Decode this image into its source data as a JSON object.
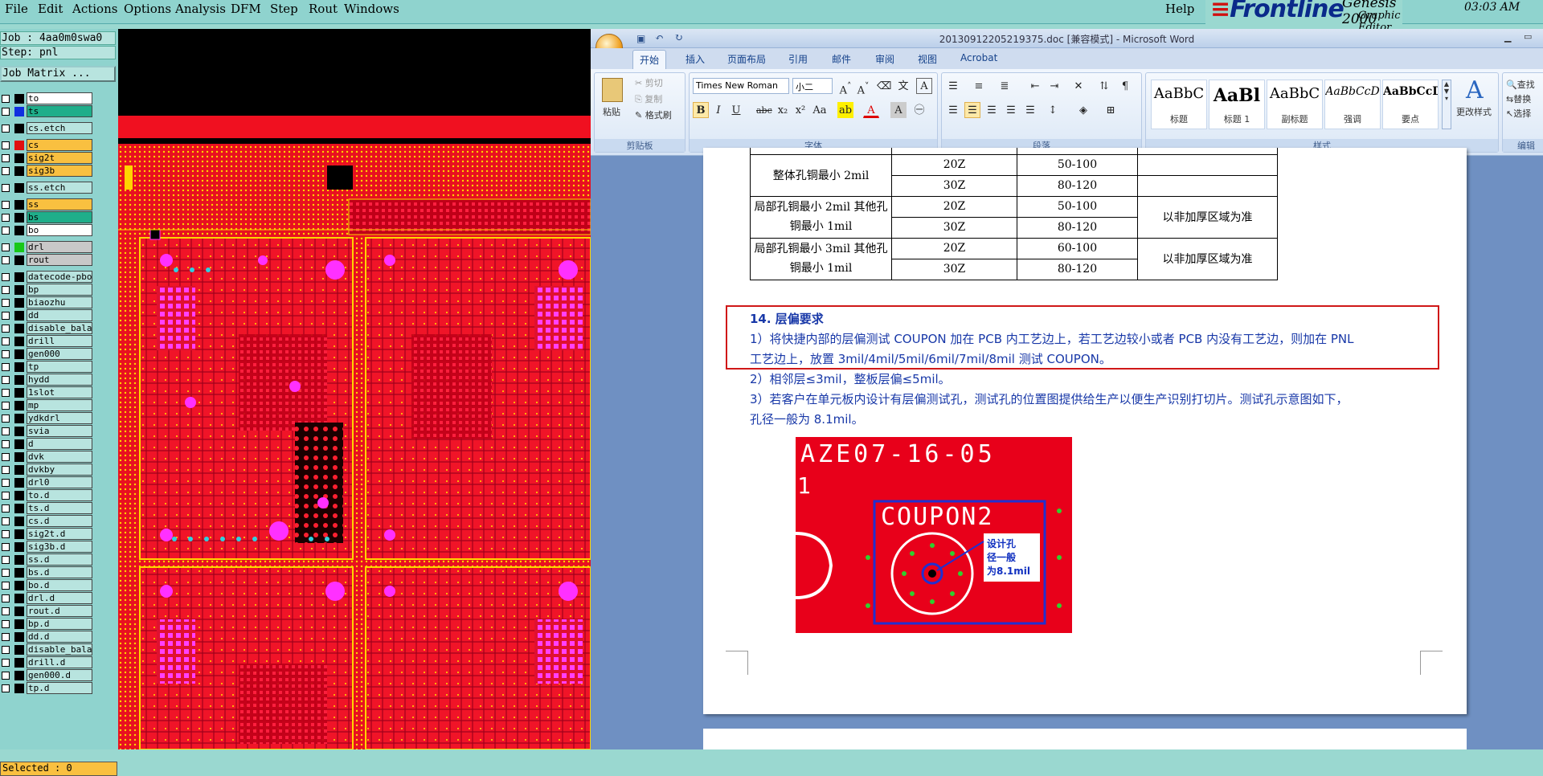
{
  "menubar": {
    "items": [
      "File",
      "Edit",
      "Actions",
      "Options",
      "Analysis",
      "DFM",
      "Step",
      "Rout",
      "Windows"
    ],
    "help": "Help",
    "brand": "Frontline",
    "product": "Genesis 2000",
    "subtitle": "Graphic Editor",
    "clock": "03:03 AM"
  },
  "left": {
    "job": "Job : 4aa0m0swa0",
    "step": "Step: pnl",
    "matrix": "Job Matrix ...",
    "layers": [
      {
        "name": "to",
        "bg": "#ffffff",
        "sw": "#000000"
      },
      {
        "name": "ts",
        "bg": "#1fae8a",
        "sw": "#1030e0"
      },
      {
        "name": "cs.etch",
        "bg": "#b8e4df",
        "sw": "#000000"
      },
      {
        "name": "cs",
        "bg": "#f9c040",
        "sw": "#e01010"
      },
      {
        "name": "sig2t",
        "bg": "#f9c040",
        "sw": "#000000"
      },
      {
        "name": "sig3b",
        "bg": "#f9c040",
        "sw": "#000000"
      },
      {
        "name": "ss.etch",
        "bg": "#b8e4df",
        "sw": "#000000"
      },
      {
        "name": "ss",
        "bg": "#f9c040",
        "sw": "#000000"
      },
      {
        "name": "bs",
        "bg": "#1fae8a",
        "sw": "#000000"
      },
      {
        "name": "bo",
        "bg": "#ffffff",
        "sw": "#000000"
      },
      {
        "name": "drl",
        "bg": "#c8c8c8",
        "sw": "#18c818"
      },
      {
        "name": "rout",
        "bg": "#c8c8c8",
        "sw": "#000000"
      },
      {
        "name": "datecode-pbo",
        "bg": "#b8e4df",
        "sw": "#000000"
      },
      {
        "name": "bp",
        "bg": "#b8e4df",
        "sw": "#000000"
      },
      {
        "name": "biaozhu",
        "bg": "#b8e4df",
        "sw": "#000000"
      },
      {
        "name": "dd",
        "bg": "#b8e4df",
        "sw": "#000000"
      },
      {
        "name": "disable_bala",
        "bg": "#b8e4df",
        "sw": "#000000"
      },
      {
        "name": "drill",
        "bg": "#b8e4df",
        "sw": "#000000"
      },
      {
        "name": "gen000",
        "bg": "#b8e4df",
        "sw": "#000000"
      },
      {
        "name": "tp",
        "bg": "#b8e4df",
        "sw": "#000000"
      },
      {
        "name": "hydd",
        "bg": "#b8e4df",
        "sw": "#000000"
      },
      {
        "name": "1slot",
        "bg": "#b8e4df",
        "sw": "#000000"
      },
      {
        "name": "mp",
        "bg": "#b8e4df",
        "sw": "#000000"
      },
      {
        "name": "ydkdrl",
        "bg": "#b8e4df",
        "sw": "#000000"
      },
      {
        "name": "svia",
        "bg": "#b8e4df",
        "sw": "#000000"
      },
      {
        "name": "d",
        "bg": "#b8e4df",
        "sw": "#000000"
      },
      {
        "name": "dvk",
        "bg": "#b8e4df",
        "sw": "#000000"
      },
      {
        "name": "dvkby",
        "bg": "#b8e4df",
        "sw": "#000000"
      },
      {
        "name": "drl0",
        "bg": "#b8e4df",
        "sw": "#000000"
      },
      {
        "name": "to.d",
        "bg": "#b8e4df",
        "sw": "#000000"
      },
      {
        "name": "ts.d",
        "bg": "#b8e4df",
        "sw": "#000000"
      },
      {
        "name": "cs.d",
        "bg": "#b8e4df",
        "sw": "#000000"
      },
      {
        "name": "sig2t.d",
        "bg": "#b8e4df",
        "sw": "#000000"
      },
      {
        "name": "sig3b.d",
        "bg": "#b8e4df",
        "sw": "#000000"
      },
      {
        "name": "ss.d",
        "bg": "#b8e4df",
        "sw": "#000000"
      },
      {
        "name": "bs.d",
        "bg": "#b8e4df",
        "sw": "#000000"
      },
      {
        "name": "bo.d",
        "bg": "#b8e4df",
        "sw": "#000000"
      },
      {
        "name": "drl.d",
        "bg": "#b8e4df",
        "sw": "#000000"
      },
      {
        "name": "rout.d",
        "bg": "#b8e4df",
        "sw": "#000000"
      },
      {
        "name": "bp.d",
        "bg": "#b8e4df",
        "sw": "#000000"
      },
      {
        "name": "dd.d",
        "bg": "#b8e4df",
        "sw": "#000000"
      },
      {
        "name": "disable_bala",
        "bg": "#b8e4df",
        "sw": "#000000"
      },
      {
        "name": "drill.d",
        "bg": "#b8e4df",
        "sw": "#000000"
      },
      {
        "name": "gen000.d",
        "bg": "#b8e4df",
        "sw": "#000000"
      },
      {
        "name": "tp.d",
        "bg": "#b8e4df",
        "sw": "#000000"
      }
    ],
    "selected": "Selected : 0"
  },
  "word": {
    "title": "20130912205219375.doc [兼容模式] - Microsoft Word",
    "tabs": [
      "开始",
      "插入",
      "页面布局",
      "引用",
      "邮件",
      "审阅",
      "视图",
      "Acrobat"
    ],
    "clipboard": {
      "paste": "粘贴",
      "cut": "剪切",
      "copy": "复制",
      "format_painter": "格式刷",
      "label": "剪贴板"
    },
    "font": {
      "name": "Times New Roman",
      "size": "小二",
      "label": "字体"
    },
    "paragraph_label": "段落",
    "styles": {
      "label": "样式",
      "items": [
        {
          "preview": "AaBbC",
          "name": "标题"
        },
        {
          "preview": "AaBl",
          "name": "标题 1"
        },
        {
          "preview": "AaBbC",
          "name": "副标题"
        },
        {
          "preview": "AaBbCcD",
          "name": "强调"
        },
        {
          "preview": "AaBbCcD",
          "name": "要点"
        }
      ],
      "change": "更改样式"
    },
    "editing": {
      "find": "查找",
      "replace": "替换",
      "select": "选择",
      "label": "编辑"
    }
  },
  "doc": {
    "table": [
      [
        "整体孔铜最小 2mil",
        "20Z",
        "50-100",
        ""
      ],
      [
        "",
        "30Z",
        "80-120",
        ""
      ],
      [
        "局部孔铜最小 2mil 其他孔铜最小 1mil",
        "20Z",
        "50-100",
        "以非加厚区域为准"
      ],
      [
        "",
        "30Z",
        "80-120",
        ""
      ],
      [
        "局部孔铜最小 3mil 其他孔铜最小 1mil",
        "20Z",
        "60-100",
        "以非加厚区域为准"
      ],
      [
        "",
        "30Z",
        "80-120",
        ""
      ]
    ],
    "heading": "14. 层偏要求",
    "p1a": "1）将快捷内部的层偏测试 COUPON  加在 PCB 内工艺边上，若工艺边较小或者 PCB 内没有工艺边，则加在 PNL",
    "p1b": "工艺边上，放置 3mil/4mil/5mil/6mil/7mil/8mil 测试 COUPON。",
    "p2": "2）相邻层≤3mil，整板层偏≤5mil。",
    "p3a": "3）若客户在单元板内设计有层偏测试孔，测试孔的位置图提供给生产以便生产识别打切片。测试孔示意图如下，",
    "p3b": "孔径一般为 8.1mil。",
    "image": {
      "code": "AZE07-16-05",
      "side": "1",
      "coupon": "COUPON2",
      "note1": "设计孔",
      "note2": "径一般",
      "note3": "为8.1mil"
    }
  }
}
